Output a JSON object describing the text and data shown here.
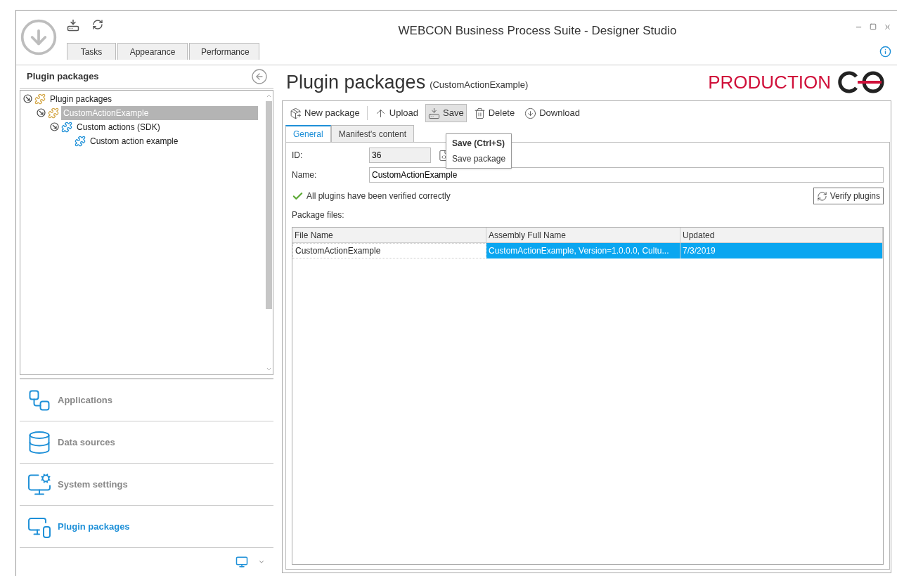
{
  "window": {
    "title": "WEBCON Business Process Suite - Designer Studio"
  },
  "ribbon_tabs": [
    {
      "label": "Tasks",
      "selected": false
    },
    {
      "label": "Appearance",
      "selected": false
    },
    {
      "label": "Performance",
      "selected": false
    }
  ],
  "sidebar": {
    "title": "Plugin packages",
    "tree": [
      {
        "label": "Plugin packages",
        "color": "#d4a84a",
        "selected": false,
        "expanded": true,
        "children": [
          {
            "label": "CustomActionExample",
            "color": "#d4a84a",
            "selected": true,
            "expanded": true,
            "children": [
              {
                "label": "Custom actions (SDK)",
                "color": "#1e90d8",
                "selected": false,
                "expanded": true,
                "children": [
                  {
                    "label": "Custom action example",
                    "color": "#1e90d8",
                    "selected": false
                  }
                ]
              }
            ]
          }
        ]
      }
    ],
    "nav": [
      {
        "label": "Applications",
        "kind": "applications",
        "selected": false
      },
      {
        "label": "Data sources",
        "kind": "datasources",
        "selected": false
      },
      {
        "label": "System settings",
        "kind": "settings",
        "selected": false
      },
      {
        "label": "Plugin packages",
        "kind": "plugins",
        "selected": true
      }
    ]
  },
  "main": {
    "title": "Plugin packages",
    "subtitle": "(CustomActionExample)",
    "environment": "PRODUCTION",
    "toolbar": [
      {
        "label": "New package",
        "kind": "new",
        "pressed": false
      },
      {
        "label": "Upload",
        "kind": "upload",
        "pressed": false
      },
      {
        "label": "Save",
        "kind": "save",
        "pressed": true
      },
      {
        "label": "Delete",
        "kind": "delete",
        "pressed": false
      },
      {
        "label": "Download",
        "kind": "download",
        "pressed": false
      }
    ],
    "tooltip": {
      "title": "Save (Ctrl+S)",
      "text": "Save package"
    },
    "tabs": [
      {
        "label": "General",
        "selected": true
      },
      {
        "label": "Manifest's content",
        "selected": false
      }
    ],
    "id_label": "ID:",
    "id_value": "36",
    "name_label": "Name:",
    "name_value": "CustomActionExample",
    "status": "All plugins have been verified correctly",
    "verify_button": "Verify plugins",
    "files_label": "Package files:",
    "table": {
      "columns": [
        "File Name",
        "Assembly Full Name",
        "Updated"
      ],
      "rows": [
        {
          "cells": [
            "CustomActionExample",
            "CustomActionExample, Version=1.0.0.0, Cultu...",
            "7/3/2019"
          ],
          "selected": true
        }
      ]
    }
  }
}
